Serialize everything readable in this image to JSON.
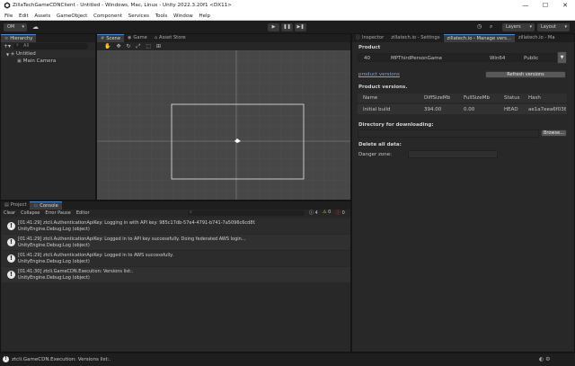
{
  "window": {
    "title": "ZillaTechGameCDNClient - Untitled - Windows, Mac, Linux - Unity 2022.3.20f1 <DX11>",
    "minimize": "—",
    "maximize": "☐",
    "close": "✕"
  },
  "menu": [
    "File",
    "Edit",
    "Assets",
    "GameObject",
    "Component",
    "Services",
    "Tools",
    "Window",
    "Help"
  ],
  "toolbar": {
    "account": "OM",
    "play": "▶",
    "pause": "❚❚",
    "step": "▶❚",
    "layers": "Layers",
    "layout": "Layout"
  },
  "hierarchy": {
    "tab": "Hierarchy",
    "search_placeholder": "All",
    "scene_name": "Untitled",
    "objects": [
      "Main Camera"
    ]
  },
  "scene": {
    "tabs": [
      "Scene",
      "Game",
      "Asset Store"
    ]
  },
  "inspector": {
    "tabs": [
      "Inspector",
      "zillatech.io - Settings",
      "zillatech.io - Manage vers...",
      "zillatech.io - Ma"
    ],
    "product_label": "Product",
    "product": {
      "id": "40",
      "name": "MPThirdPersonGame",
      "platform": "Win64",
      "visibility": "Public"
    },
    "product_versions_link": "product versions",
    "refresh_button": "Refresh versions",
    "versions_header": "Product versions.",
    "table": {
      "columns": [
        "Name",
        "DiffSizeMb",
        "FullSizeMb",
        "Status",
        "Hash"
      ],
      "rows": [
        [
          "Initial build",
          "394.00",
          "0.00",
          "HEAD",
          "ae1a7eea6f0387"
        ]
      ]
    },
    "download_header": "Directory for downloading:",
    "browse_button": "Browse...",
    "delete_header": "Delete all data:",
    "danger_zone_label": "Danger zone:"
  },
  "console": {
    "tabs": [
      "Project",
      "Console"
    ],
    "toolbar": [
      "Clear",
      "Collapse",
      "Error Pause",
      "Editor"
    ],
    "counts": {
      "logs": "4",
      "warnings": "0",
      "errors": "0"
    },
    "entries": [
      {
        "line1": "[01:41:29] ztcli.AuthenticationApiKey: Logging in with API key: 985c17db-57e4-4791-b741-7a5096c6cd8f.",
        "line2": "UnityEngine.Debug:Log (object)"
      },
      {
        "line1": "[01:41:29] ztcli.AuthenticationApiKey: Logged in to API key successfully. Doing federated AWS login...",
        "line2": "UnityEngine.Debug:Log (object)"
      },
      {
        "line1": "[01:41:29] ztcli.AuthenticationApiKey: Logged in to AWS successfully.",
        "line2": "UnityEngine.Debug:Log (object)"
      },
      {
        "line1": "[01:41:30] ztcli.GameCDN.Execution: Versions list:.",
        "line2": "UnityEngine.Debug:Log (object)"
      }
    ]
  },
  "status": {
    "text": "ztcli.GameCDN.Execution: Versions list:."
  }
}
